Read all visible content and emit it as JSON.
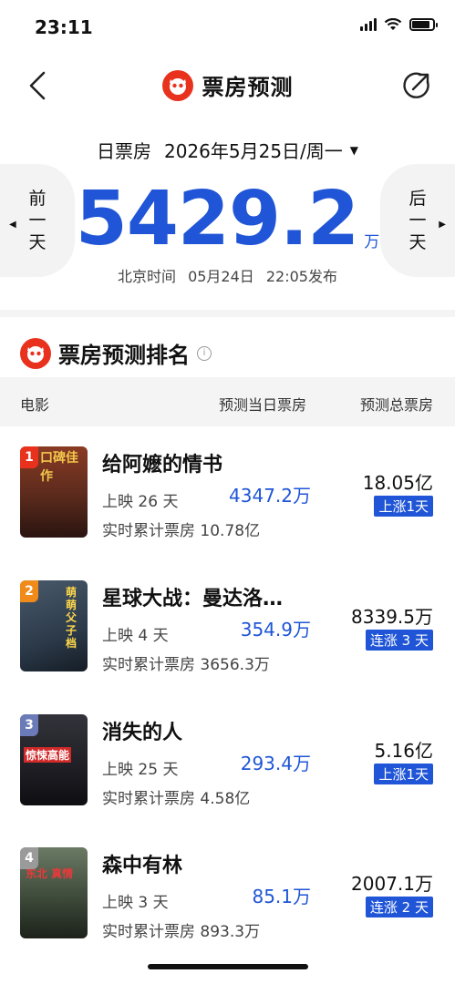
{
  "status_bar": {
    "time": "23:11"
  },
  "nav": {
    "title": "票房预测"
  },
  "date": {
    "label": "日票房",
    "value": "2026年5月25日/周一"
  },
  "prev_day": {
    "chars": [
      "前",
      "一",
      "天"
    ]
  },
  "next_day": {
    "chars": [
      "后",
      "一",
      "天"
    ]
  },
  "forecast": {
    "value": "5429.2",
    "unit": "万"
  },
  "publish": {
    "text": "北京时间 05月24日 22:05发布"
  },
  "section": {
    "title": "票房预测排名"
  },
  "table_header": {
    "movie": "电影",
    "day_forecast": "预测当日票房",
    "total_forecast": "预测总票房"
  },
  "movies": [
    {
      "rank": "1",
      "title": "给阿嬷的情书",
      "days": "上映 26 天",
      "cumulative": "实时累计票房 10.78亿",
      "day_forecast": "4347.2万",
      "total_forecast": "18.05亿",
      "trend": "上涨1天",
      "badge_color": "#e8321e",
      "poster_color": "#5a2a1c",
      "poster_words": "口碑佳作"
    },
    {
      "rank": "2",
      "title": "星球大战：曼达洛…",
      "days": "上映 4 天",
      "cumulative": "实时累计票房 3656.3万",
      "day_forecast": "354.9万",
      "total_forecast": "8339.5万",
      "trend": "连涨 3 天",
      "badge_color": "#f08a1a",
      "poster_color": "#2c3a4a",
      "poster_words": "萌萌父子档"
    },
    {
      "rank": "3",
      "title": "消失的人",
      "days": "上映 25 天",
      "cumulative": "实时累计票房 4.58亿",
      "day_forecast": "293.4万",
      "total_forecast": "5.16亿",
      "trend": "上涨1天",
      "badge_color": "#6b7bb8",
      "poster_color": "#1e1e24",
      "poster_words": "惊悚高能"
    },
    {
      "rank": "4",
      "title": "森中有林",
      "days": "上映 3 天",
      "cumulative": "实时累计票房 893.3万",
      "day_forecast": "85.1万",
      "total_forecast": "2007.1万",
      "trend": "连涨 2 天",
      "badge_color": "#9a9a9a",
      "poster_color": "#3e4a3a",
      "poster_words": "东北 真情"
    }
  ]
}
